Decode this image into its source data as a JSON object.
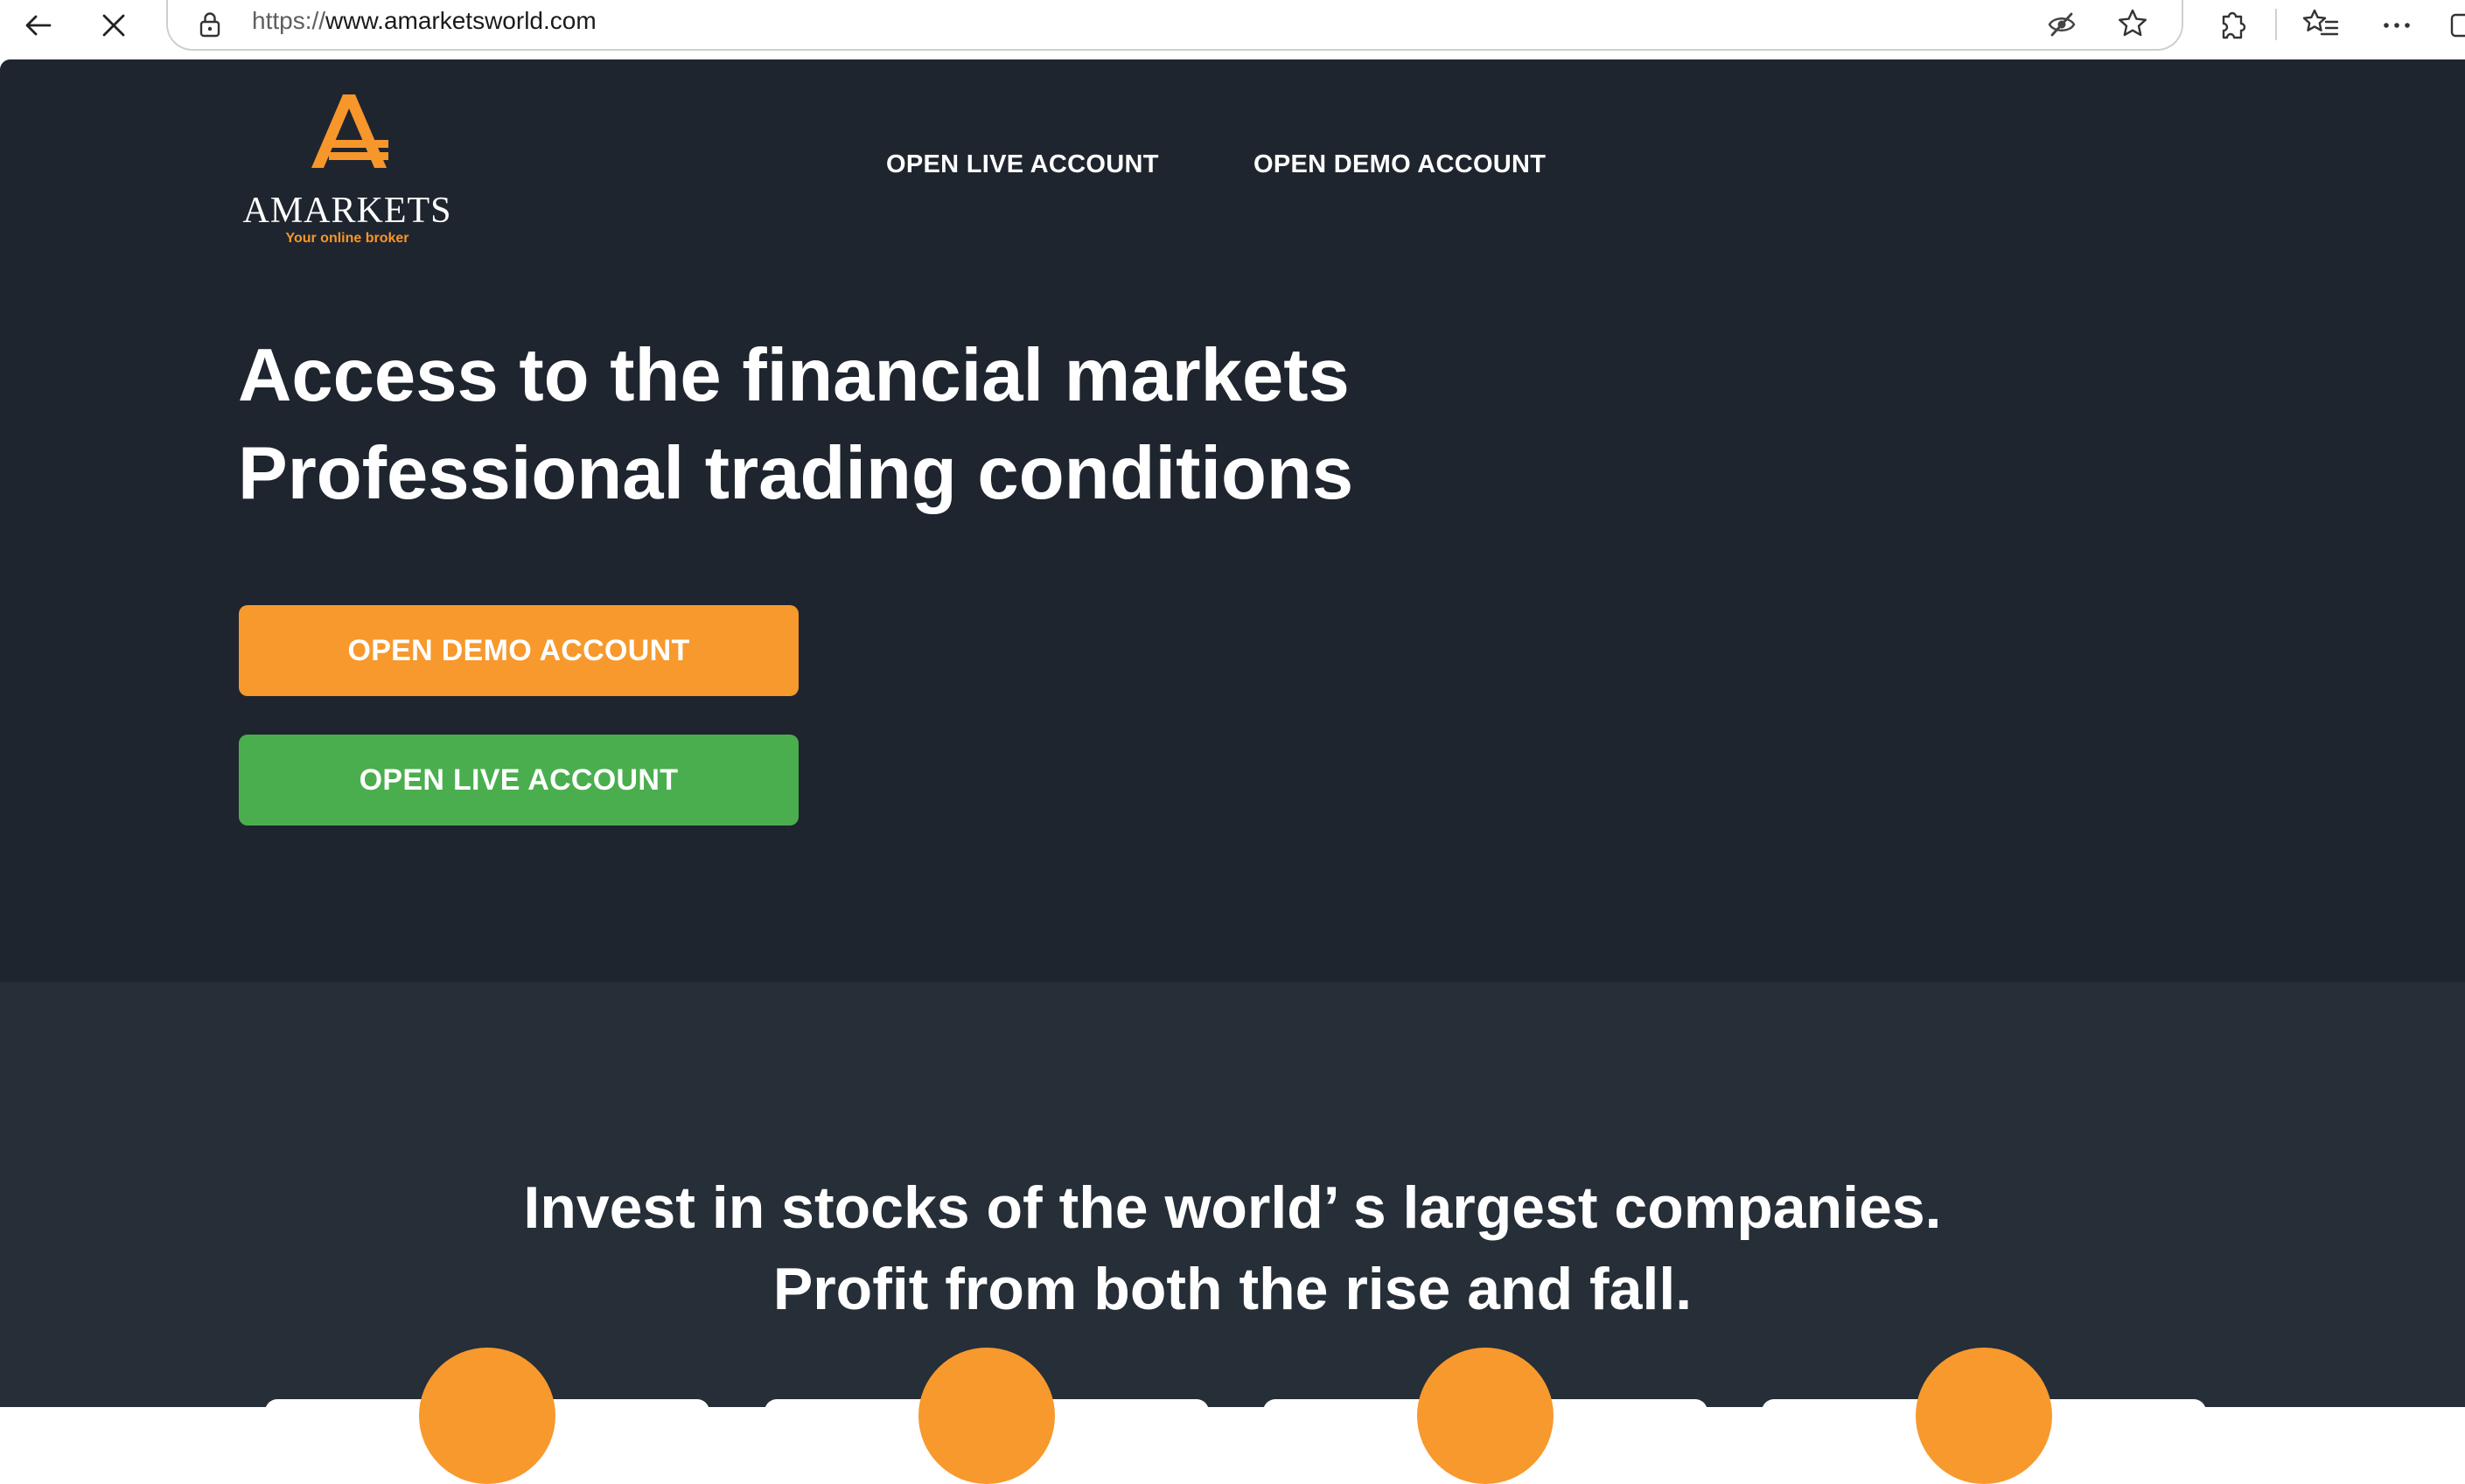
{
  "browser": {
    "url_protocol": "https://",
    "url_host": "www.amarketsworld.com",
    "icons": [
      "back-arrow-icon",
      "close-icon",
      "lock-icon",
      "tracking-prevention-icon",
      "favorite-star-icon",
      "extensions-icon",
      "favorites-icon",
      "more-icon"
    ]
  },
  "site": {
    "logo": {
      "mark": "A",
      "wordmark": "AMARKETS",
      "tagline": "Your online broker"
    },
    "topnav": {
      "live_label": "OPEN LIVE ACCOUNT",
      "demo_label": "OPEN DEMO ACCOUNT"
    },
    "hero": {
      "title_line1": "Access to the financial markets",
      "title_line2": "Professional trading conditions",
      "demo_button": "OPEN DEMO ACCOUNT",
      "live_button": "OPEN LIVE ACCOUNT"
    },
    "stocks": {
      "title_line1": "Invest in stocks of the world’ s largest companies.",
      "title_line2": "Profit from both the rise and fall."
    }
  },
  "colors": {
    "brand_orange": "#f7992d",
    "green": "#4aae4f",
    "hero_bg": "#1f252e",
    "section_bg": "#262e37"
  }
}
